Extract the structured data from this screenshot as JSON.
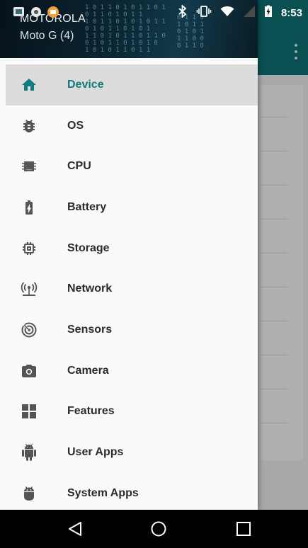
{
  "status_bar": {
    "time": "8:53",
    "icons": [
      "notification-icon",
      "bluetooth-icon",
      "vibrate-icon",
      "wifi-icon",
      "no-sim-icon",
      "battery-charging-icon"
    ]
  },
  "drawer": {
    "header": {
      "title": "MOTOROLA",
      "subtitle": "Moto G (4)"
    },
    "items": [
      {
        "label": "Device",
        "icon": "home-icon",
        "active": true
      },
      {
        "label": "OS",
        "icon": "bug-icon",
        "active": false
      },
      {
        "label": "CPU",
        "icon": "chip-icon",
        "active": false
      },
      {
        "label": "Battery",
        "icon": "battery-icon",
        "active": false
      },
      {
        "label": "Storage",
        "icon": "storage-chip-icon",
        "active": false
      },
      {
        "label": "Network",
        "icon": "network-icon",
        "active": false
      },
      {
        "label": "Sensors",
        "icon": "sensor-icon",
        "active": false
      },
      {
        "label": "Camera",
        "icon": "camera-icon",
        "active": false
      },
      {
        "label": "Features",
        "icon": "features-grid-icon",
        "active": false
      },
      {
        "label": "User Apps",
        "icon": "android-icon",
        "active": false
      },
      {
        "label": "System Apps",
        "icon": "android-head-icon",
        "active": false
      }
    ]
  },
  "colors": {
    "accent": "#0f7c82",
    "appbar": "#0f6f72",
    "active_bg": "#dcdcdc"
  },
  "nav_bar": {
    "buttons": [
      "back-icon",
      "home-circle-icon",
      "recents-icon"
    ]
  }
}
